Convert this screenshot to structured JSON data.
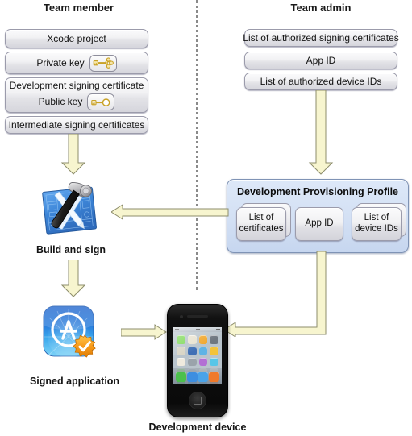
{
  "columns": {
    "member_title": "Team member",
    "admin_title": "Team admin"
  },
  "member_boxes": [
    {
      "label": "Xcode project"
    },
    {
      "label": "Private key",
      "icon": "private-key-icon"
    },
    {
      "label": "Development signing certificate",
      "sublabel": "Public key",
      "icon": "public-key-icon"
    },
    {
      "label": "Intermediate signing certificates"
    }
  ],
  "admin_boxes": [
    {
      "label": "List of authorized signing certificates"
    },
    {
      "label": "App ID"
    },
    {
      "label": "List of authorized device IDs"
    }
  ],
  "profile": {
    "title": "Development Provisioning Profile",
    "items": [
      {
        "line1": "List of",
        "line2": "certificates",
        "stacked": true
      },
      {
        "line1": "App ID",
        "line2": "",
        "stacked": false
      },
      {
        "line1": "List of",
        "line2": "device IDs",
        "stacked": true
      }
    ]
  },
  "nodes": {
    "build_and_sign": "Build and sign",
    "signed_application": "Signed application",
    "development_device": "Development device"
  },
  "colors": {
    "arrow_fill": "#f7f5cf",
    "arrow_stroke": "#8d8d6b",
    "profile_bg": "#d7e3f5",
    "profile_border": "#7f93b5",
    "box_border": "#9b9bab",
    "divider": "#8a8a8a",
    "badge_orange": "#f59b18"
  },
  "phone_icon_colors": [
    "#7ed957",
    "#e8e2cf",
    "#f0a830",
    "#6f7780",
    "#d8d4c4",
    "#3f6fb5",
    "#5fb3e6",
    "#f3c33b",
    "#efeade",
    "#9aa3ab",
    "#b36fd4",
    "#58c6e8",
    "#7ed957",
    "#a8aeb5",
    "#e8e2cf",
    "#eceadf",
    "#4cc04c",
    "#3d8ee0",
    "#4aa3e8",
    "#f07a2a"
  ],
  "phone_dock_colors": [
    "#4cc04c",
    "#3d8ee0",
    "#4aa3e8",
    "#f07a2a"
  ]
}
